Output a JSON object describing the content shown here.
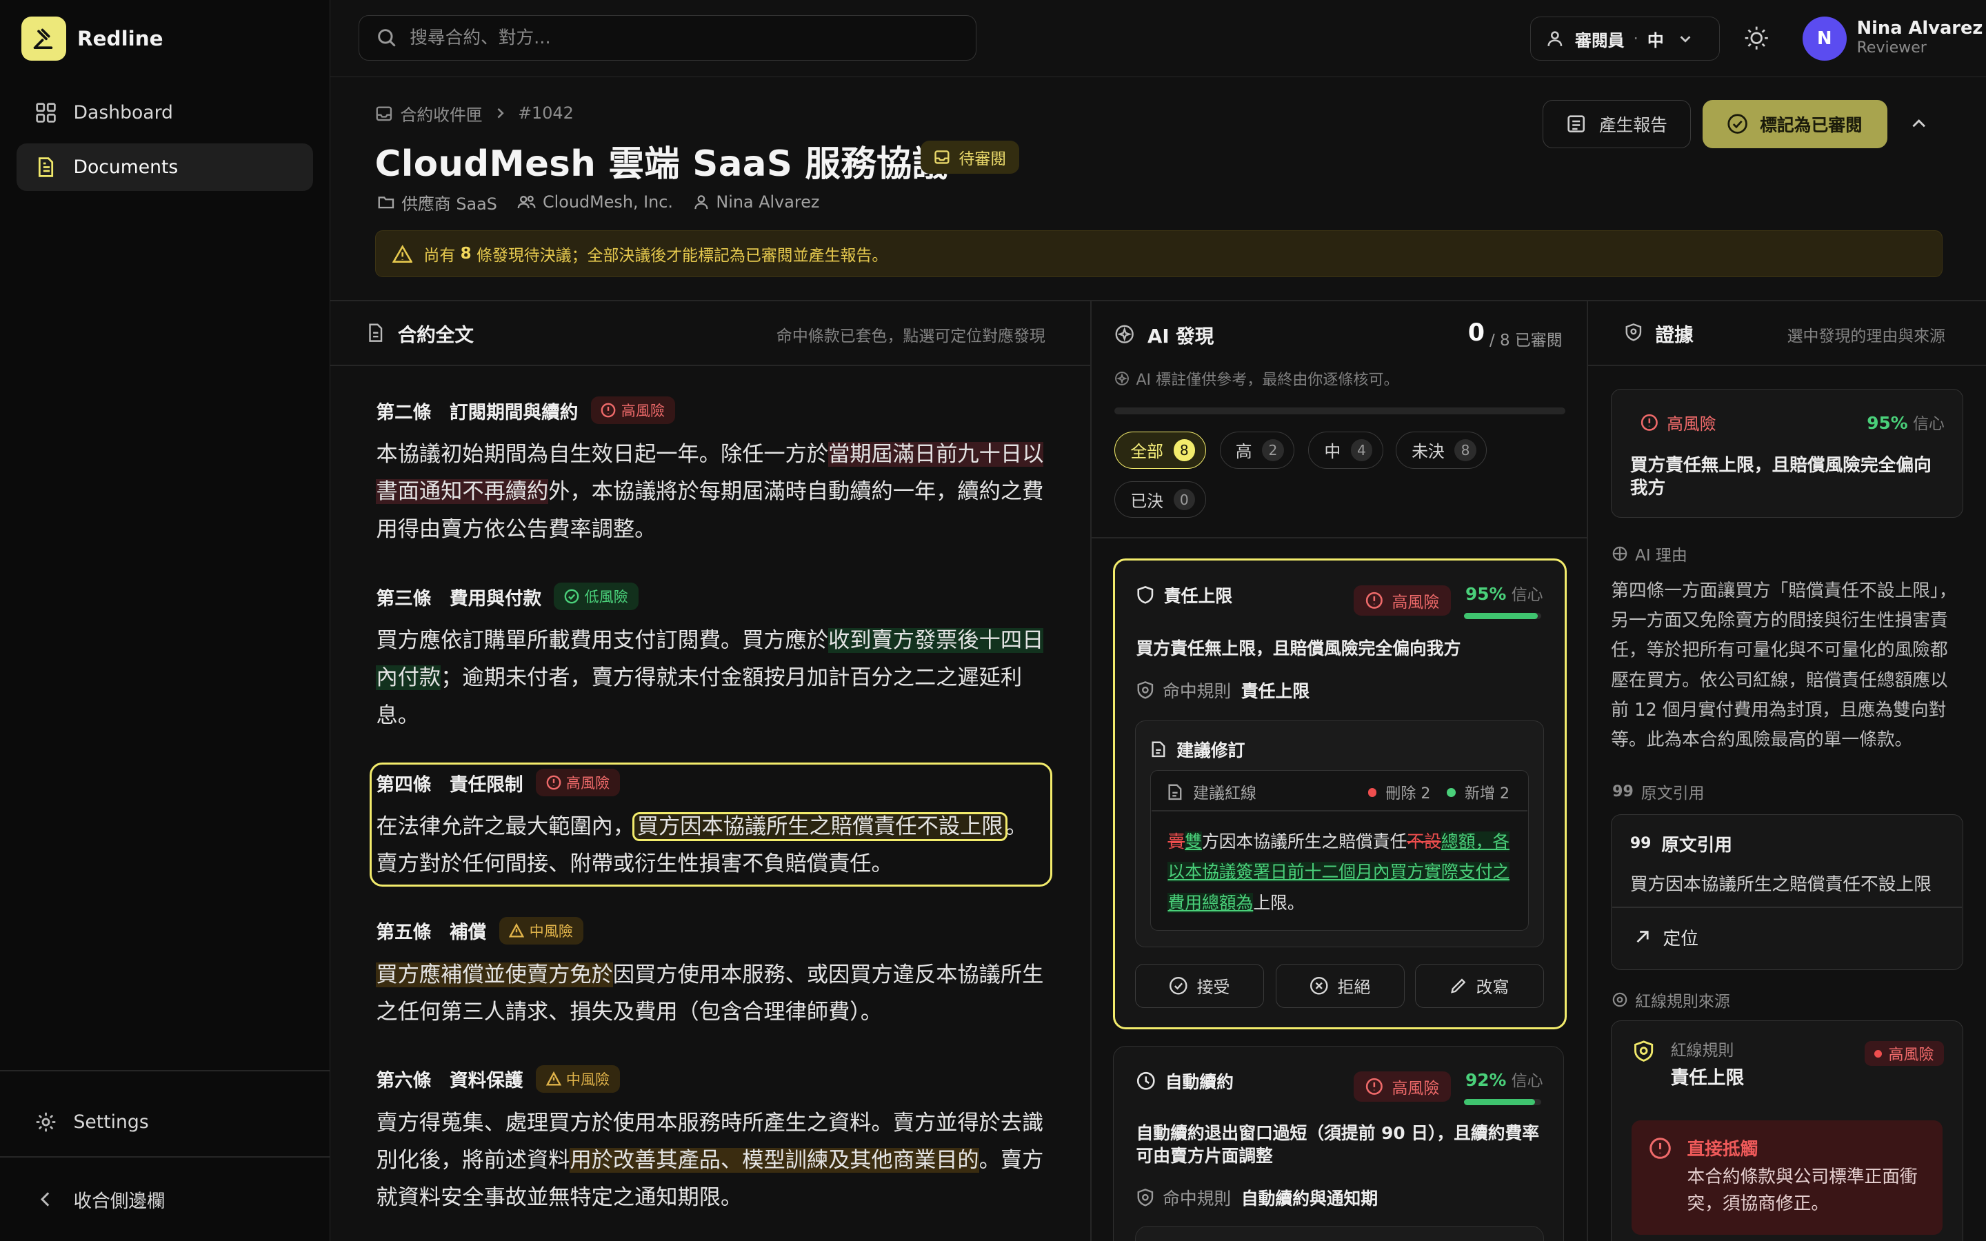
{
  "app": {
    "name": "Redline"
  },
  "sidebar": {
    "items": [
      {
        "label": "Dashboard",
        "icon": "grid-icon"
      },
      {
        "label": "Documents",
        "icon": "document-icon"
      }
    ],
    "settings_label": "Settings",
    "collapse_label": "收合側邊欄"
  },
  "topbar": {
    "search_placeholder": "搜尋合約、對方...",
    "role_label": "審閱員",
    "role_sep": "·",
    "role_level": "中",
    "user": {
      "initial": "N",
      "name": "Nina Alvarez",
      "role": "Reviewer"
    }
  },
  "header": {
    "breadcrumb": [
      "合約收件匣",
      "#1042"
    ],
    "title": "CloudMesh 雲端 SaaS 服務協議",
    "status": "待審閱",
    "meta": {
      "category": "供應商 SaaS",
      "counterparty": "CloudMesh, Inc.",
      "owner": "Nina Alvarez"
    },
    "report_button": "產生報告",
    "mark_button": "標記為已審閱",
    "banner": {
      "prefix": "尚有",
      "count": "8",
      "suffix": "條發現待決議；全部決議後才能標記為已審閱並產生報告。"
    }
  },
  "contract": {
    "title": "合約全文",
    "hint": "命中條款已套色，點選可定位對應發現",
    "clauses": [
      {
        "heading": "第二條　訂閱期間與續約",
        "risk": "高風險",
        "pre": "本協議初始期間為自生效日起一年。除任一方於",
        "hl": "當期屆滿日前九十日以書面通知不再續約",
        "post": "外，本協議將於每期屆滿時自動續約一年，續約之費用得由賣方依公告費率調整。"
      },
      {
        "heading": "第三條　費用與付款",
        "risk": "低風險",
        "pre": "買方應依訂購單所載費用支付訂閱費。買方應於",
        "hl": "收到賣方發票後十四日內付款",
        "post": "；逾期未付者，賣方得就未付金額按月加計百分之二之遲延利息。"
      },
      {
        "heading": "第四條　責任限制",
        "risk": "高風險",
        "pre": "在法律允許之最大範圍內，",
        "hl": "買方因本協議所生之賠償責任不設上限",
        "post": "。賣方對於任何間接、附帶或衍生性損害不負賠償責任。"
      },
      {
        "heading": "第五條　補償",
        "risk": "中風險",
        "pre": "",
        "hl": "買方應補償並使賣方免於",
        "post": "因買方使用本服務、或因買方違反本協議所生之任何第三人請求、損失及費用（包含合理律師費）。"
      },
      {
        "heading": "第六條　資料保護",
        "risk": "中風險",
        "pre": "賣方得蒐集、處理買方於使用本服務時所產生之資料。賣方並得於去識別化後，將前述資料",
        "hl": "用於改善其產品、模型訓練及其他商業目的",
        "post": "。賣方就資料安全事故並無特定之通知期限。"
      }
    ]
  },
  "findings": {
    "title": "AI 發現",
    "reviewed": "0",
    "total_text": "/ 8 已審閱",
    "note": "AI 標註僅供參考，最終由你逐條核可。",
    "progress": 0,
    "filters": [
      {
        "label": "全部",
        "count": "8"
      },
      {
        "label": "高",
        "count": "2"
      },
      {
        "label": "中",
        "count": "4"
      },
      {
        "label": "未決",
        "count": "8"
      },
      {
        "label": "已決",
        "count": "0"
      }
    ],
    "cards": [
      {
        "category": "責任上限",
        "risk": "高風險",
        "confidence": "95%",
        "confidence_value": 0.95,
        "conf_label": "信心",
        "summary": "買方責任無上限，且賠償風險完全偏向我方",
        "rule_label": "命中規則",
        "rule": "責任上限",
        "suggest_title": "建議修訂",
        "redline_title": "建議紅線",
        "del_count": "刪除 2",
        "ins_count": "新增 2",
        "redline": {
          "d1": "賣",
          "i1": "雙",
          "t1": "方因本協議所生之賠償責任",
          "d2": "不設",
          "i2": "總額，各以本協議簽署日前十二個月內買方實際支付之費用總額為",
          "t2": "上限。"
        },
        "actions": [
          "接受",
          "拒絕",
          "改寫"
        ]
      },
      {
        "category": "自動續約",
        "risk": "高風險",
        "confidence": "92%",
        "confidence_value": 0.92,
        "conf_label": "信心",
        "summary": "自動續約退出窗口過短（須提前 90 日），且續約費率可由賣方片面調整",
        "rule_label": "命中規則",
        "rule": "自動續約與通知期"
      }
    ]
  },
  "evidence": {
    "title": "證據",
    "hint": "選中發現的理由與來源",
    "risk": "高風險",
    "confidence": "95%",
    "conf_label": "信心",
    "summary": "買方責任無上限，且賠償風險完全偏向我方",
    "reason_label": "AI 理由",
    "reason": "第四條一方面讓買方「賠償責任不設上限」，另一方面又免除賣方的間接與衍生性損害責任，等於把所有可量化與不可量化的風險都壓在買方。依公司紅線，賠償責任總額應以前 12 個月實付費用為封頂，且應為雙向對等。此為本合約風險最高的單一條款。",
    "quote_label": "原文引用",
    "quote_title": "原文引用",
    "quote": "買方因本協議所生之賠償責任不設上限",
    "locate": "定位",
    "rule_source_label": "紅線規則來源",
    "rule_kind": "紅線規則",
    "rule_name": "責任上限",
    "rule_risk": "高風險",
    "conflict_title": "直接抵觸",
    "conflict_text": "本合約條款與公司標準正面衝突，須協商修正。"
  },
  "colors": {
    "accent": "#f3ec6c",
    "high": "#ef6a6a",
    "medium": "#e0b34a",
    "low": "#4ad07a"
  }
}
